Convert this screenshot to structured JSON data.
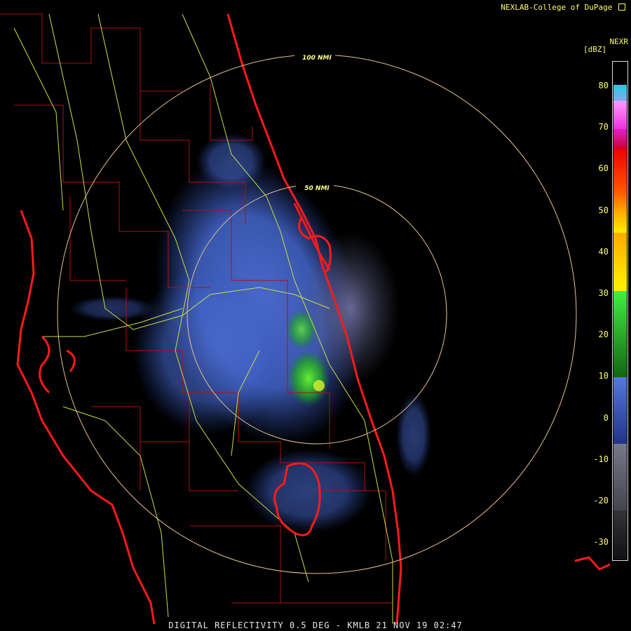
{
  "header": {
    "credit": "NEXLAB-College of DuPage",
    "credit_icon": "external-link-icon"
  },
  "legend": {
    "product": "NEXR",
    "unit": "[dBZ]",
    "ticks": [
      "80",
      "70",
      "60",
      "50",
      "40",
      "30",
      "20",
      "10",
      "0",
      "-10",
      "-20",
      "-30"
    ],
    "colors": {
      "purple": "#2a2a35",
      "gray": "#6a6a80",
      "blue": "#4466cc",
      "green": "#22bb22",
      "yellow": "#ffee00",
      "orange": "#ff8800",
      "red": "#ee0000",
      "magenta": "#ee22ee",
      "pink": "#ff99ff",
      "cyan": "#33ccdd"
    }
  },
  "range_rings": {
    "outer": "100 NMI",
    "inner": "50 NMI"
  },
  "caption": "DIGITAL REFLECTIVITY 0.5 DEG - KMLB 21 NOV 19 02:47"
}
